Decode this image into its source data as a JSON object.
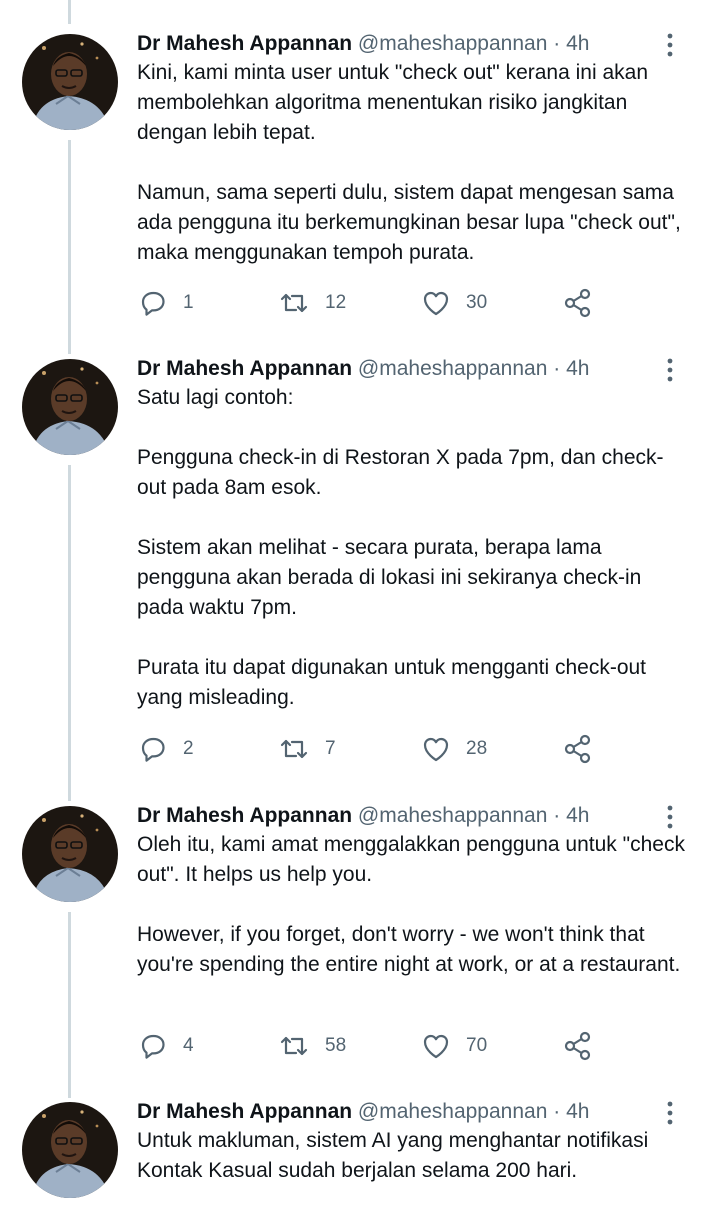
{
  "author": {
    "name": "Dr Mahesh Appannan",
    "handle": "@maheshappannan",
    "separator": "·"
  },
  "tweets": [
    {
      "time": "4h",
      "paragraphs": [
        "Kini, kami minta user untuk \"check out\" kerana ini akan membolehkan algoritma menentukan risiko jangkitan dengan lebih tepat.",
        "Namun, sama seperti dulu, sistem dapat mengesan sama ada pengguna itu berkemungkinan besar lupa \"check out\", maka menggunakan tempoh purata."
      ],
      "replies": "1",
      "retweets": "12",
      "likes": "30"
    },
    {
      "time": "4h",
      "paragraphs": [
        "Satu lagi contoh:",
        "Pengguna check-in di Restoran X pada 7pm, dan check-out pada 8am esok.",
        "Sistem akan melihat - secara purata, berapa lama pengguna akan berada di lokasi ini sekiranya check-in pada waktu 7pm.",
        "Purata itu dapat digunakan untuk mengganti check-out yang misleading."
      ],
      "replies": "2",
      "retweets": "7",
      "likes": "28"
    },
    {
      "time": "4h",
      "paragraphs": [
        "Oleh itu, kami amat menggalakkan pengguna untuk \"check out\". It helps us help you.",
        "However, if you forget, don't worry - we won't think that you're spending the entire night at work, or at a restaurant."
      ],
      "replies": "4",
      "retweets": "58",
      "likes": "70"
    },
    {
      "time": "4h",
      "paragraphs": [
        "Untuk makluman, sistem AI yang menghantar notifikasi Kontak Kasual sudah berjalan selama 200 hari."
      ]
    }
  ],
  "icons": {
    "more": "more-vertical-icon",
    "reply": "reply-icon",
    "retweet": "retweet-icon",
    "like": "heart-icon",
    "share": "share-icon"
  },
  "colors": {
    "text": "#0f1419",
    "secondary": "#536471",
    "thread_line": "#cfd9de"
  }
}
